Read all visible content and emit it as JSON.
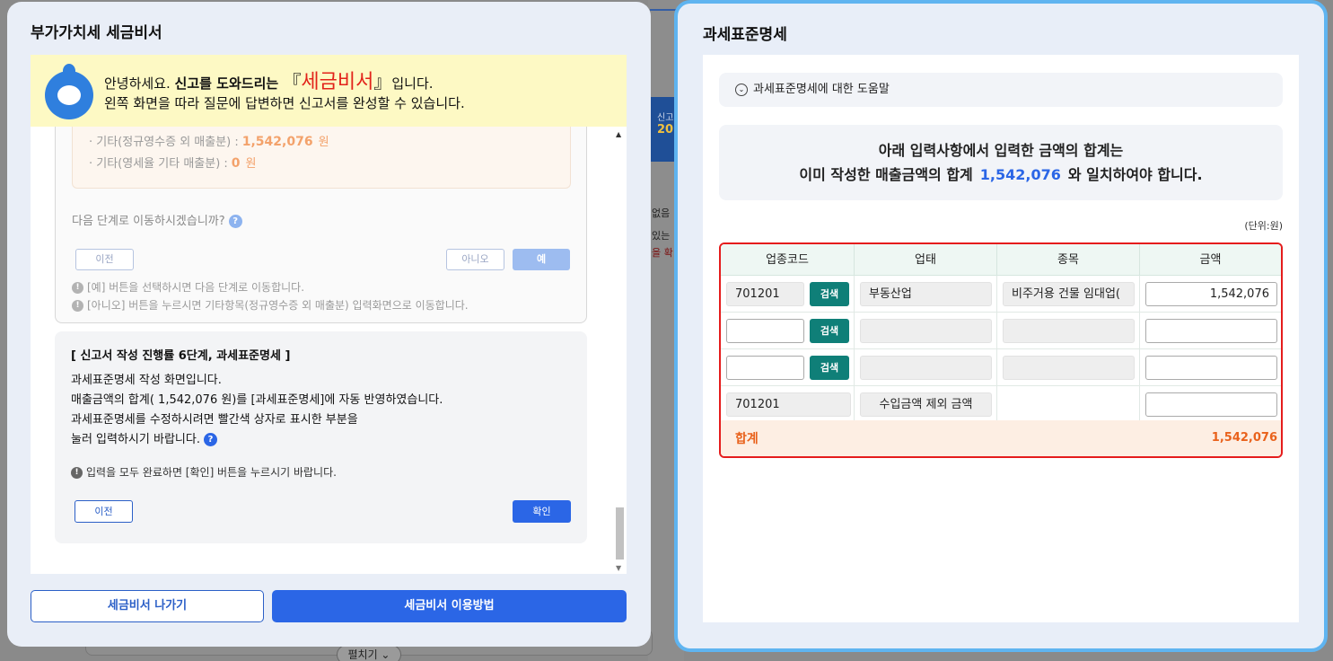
{
  "background": {
    "bg_text_1": "없음",
    "bg_text_2": "있는",
    "bg_text_3": "을 확",
    "bg_blue_label": "신고",
    "bg_blue_value": "20",
    "expand_label": "펼치기 ⌄"
  },
  "left_modal": {
    "title": "부가가치세 세금비서",
    "banner": {
      "greeting": "안녕하세요. ",
      "bold_text": "신고를 도와드리는 ",
      "open_bracket": "『",
      "brand": "세금비서",
      "close_bracket": "』",
      "suffix": "입니다.",
      "line2": "왼쪽 화면을 따라 질문에 답변하면 신고서를 완성할 수 있습니다."
    },
    "prev_card": {
      "rows": [
        {
          "label": "· 기타(정규영수증 외 매출분) :",
          "amount": "1,542,076",
          "unit": "원"
        },
        {
          "label": "· 기타(영세율 기타 매출분) :",
          "amount": "0",
          "unit": "원"
        }
      ],
      "question": "다음 단계로 이동하시겠습니까?",
      "prev_label": "이전",
      "no_label": "아니오",
      "yes_label": "예",
      "notes": [
        "[예] 버튼을 선택하시면 다음 단계로 이동합니다.",
        "[아니오] 버튼을 누르시면 기타항목(정규영수증 외 매출분) 입력화면으로 이동합니다."
      ]
    },
    "step_card": {
      "title": "[ 신고서 작성 진행률 6단계, 과세표준명세 ]",
      "lines": [
        "과세표준명세 작성 화면입니다.",
        "매출금액의 합계( 1,542,076 원)를 [과세표준명세]에 자동 반영하였습니다.",
        "과세표준명세를 수정하시려면 빨간색 상자로 표시한 부분을",
        "눌러 입력하시기 바랍니다."
      ],
      "note": "입력을 모두 완료하면 [확인] 버튼을 누르시기 바랍니다.",
      "prev_label": "이전",
      "ok_label": "확인"
    },
    "exit_label": "세금비서 나가기",
    "howto_label": "세금비서 이용방법"
  },
  "right_modal": {
    "title": "과세표준명세",
    "help_label": "과세표준명세에 대한 도움말",
    "notice_line1": "아래 입력사항에서 입력한 금액의 합계는",
    "notice_line2_pre": "이미 작성한 매출금액의 합계",
    "notice_amount": "1,542,076",
    "notice_line2_post": "와 일치하여야 합니다.",
    "unit": "(단위:원)",
    "table": {
      "headers": [
        "업종코드",
        "업태",
        "종목",
        "금액"
      ],
      "search_label": "검색",
      "rows": [
        {
          "code": "701201",
          "business": "부동산업",
          "item": "비주거용 건물 임대업(",
          "amount": "1,542,076"
        },
        {
          "code": "",
          "business": "",
          "item": "",
          "amount": ""
        },
        {
          "code": "",
          "business": "",
          "item": "",
          "amount": ""
        },
        {
          "code": "701201",
          "business": "수입금액 제외 금액",
          "item": "",
          "amount": ""
        }
      ],
      "total_label": "합계",
      "total_value": "1,542,076"
    }
  }
}
